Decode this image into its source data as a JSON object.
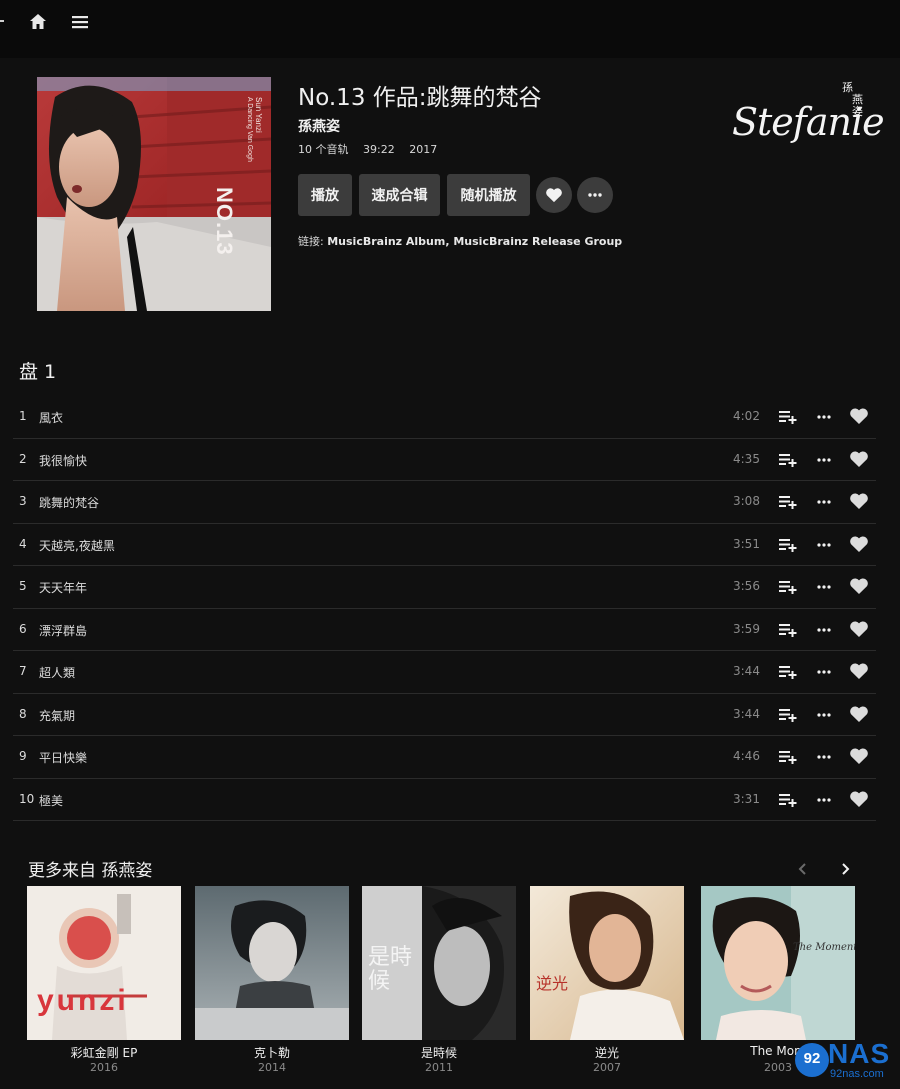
{
  "album": {
    "title": "No.13 作品:跳舞的梵谷",
    "artist": "孫燕姿",
    "track_count": "10 个音轨",
    "duration": "39:22",
    "year": "2017",
    "buttons": {
      "play": "播放",
      "quick_mix": "速成合辑",
      "shuffle": "随机播放"
    },
    "links_label": "链接:",
    "links": "MusicBrainz Album, MusicBrainz Release Group",
    "cover_text": {
      "big": "NO.13",
      "small": "Sun Yanzi",
      "sub": "A Dancing Van Gogh"
    },
    "signature": {
      "text": "Stefanie",
      "chars": [
        "孫",
        "燕",
        "姿"
      ]
    }
  },
  "disc": {
    "label": "盘 1"
  },
  "tracks": [
    {
      "no": "1",
      "title": "風衣",
      "duration": "4:02"
    },
    {
      "no": "2",
      "title": "我很愉快",
      "duration": "4:35"
    },
    {
      "no": "3",
      "title": "跳舞的梵谷",
      "duration": "3:08"
    },
    {
      "no": "4",
      "title": "天越亮,夜越黑",
      "duration": "3:51"
    },
    {
      "no": "5",
      "title": "天天年年",
      "duration": "3:56"
    },
    {
      "no": "6",
      "title": "漂浮群島",
      "duration": "3:59"
    },
    {
      "no": "7",
      "title": "超人類",
      "duration": "3:44"
    },
    {
      "no": "8",
      "title": "充氣期",
      "duration": "3:44"
    },
    {
      "no": "9",
      "title": "平日快樂",
      "duration": "4:46"
    },
    {
      "no": "10",
      "title": "極美",
      "duration": "3:31"
    }
  ],
  "more_from": {
    "title": "更多来自 孫燕姿",
    "albums": [
      {
        "title": "彩虹金剛 EP",
        "year": "2016",
        "cover_text": "yunzi"
      },
      {
        "title": "克卜勒",
        "year": "2014"
      },
      {
        "title": "是時候",
        "year": "2011",
        "cover_text": "是時候"
      },
      {
        "title": "逆光",
        "year": "2007",
        "cover_text": "逆光"
      },
      {
        "title": "The Mom",
        "year": "2003",
        "cover_text": "The Moment"
      }
    ]
  },
  "watermark": {
    "logo": "92",
    "brand": "NAS",
    "url": "92nas.com"
  },
  "icons": {
    "home": "home-icon",
    "menu": "hamburger-menu-icon",
    "heart": "heart-icon",
    "more": "more-horizontal-icon",
    "add_queue": "playlist-add-icon",
    "prev": "chevron-left-icon",
    "next": "chevron-right-icon"
  },
  "colors": {
    "background": "#101010",
    "topbar": "#0a0a0a",
    "button": "#3c3c3c",
    "accent_blue": "#1b6fd0"
  }
}
